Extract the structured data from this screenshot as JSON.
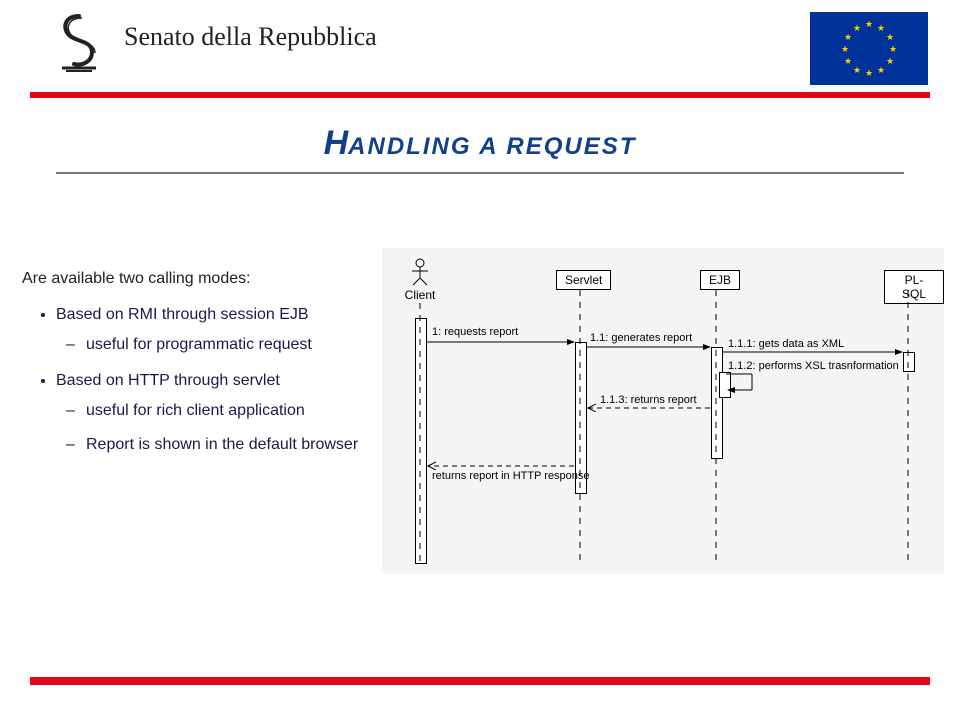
{
  "header": {
    "org_name": "Senato della Repubblica",
    "flag_name": "eu-flag"
  },
  "title": {
    "first_letter": "H",
    "rest": "ANDLING A REQUEST"
  },
  "body": {
    "intro": "Are available two calling modes:",
    "items": [
      {
        "label": "Based on RMI through session EJB",
        "sub": [
          "useful for programmatic request"
        ]
      },
      {
        "label": "Based on HTTP through servlet",
        "sub": [
          "useful for rich client application",
          "Report is shown in the default browser"
        ]
      }
    ]
  },
  "diagram": {
    "type": "uml-sequence",
    "actor": "Client",
    "lifelines": [
      "Servlet",
      "EJB",
      "PL-SQL"
    ],
    "messages": {
      "m1": "1: requests report",
      "m11": "1.1: generates report",
      "m111": "1.1.1: gets data as XML",
      "m112": "1.1.2: performs XSL trasnformation",
      "m113": "1.1.3: returns report",
      "ret": "returns report in HTTP response"
    }
  },
  "chart_data": {
    "type": "sequence-diagram",
    "participants": [
      {
        "name": "Client",
        "kind": "actor"
      },
      {
        "name": "Servlet",
        "kind": "object"
      },
      {
        "name": "EJB",
        "kind": "object"
      },
      {
        "name": "PL-SQL",
        "kind": "object"
      }
    ],
    "messages": [
      {
        "seq": "1",
        "from": "Client",
        "to": "Servlet",
        "label": "requests report",
        "style": "call"
      },
      {
        "seq": "1.1",
        "from": "Servlet",
        "to": "EJB",
        "label": "generates report",
        "style": "call"
      },
      {
        "seq": "1.1.1",
        "from": "EJB",
        "to": "PL-SQL",
        "label": "gets data as XML",
        "style": "call"
      },
      {
        "seq": "1.1.2",
        "from": "EJB",
        "to": "EJB",
        "label": "performs XSL trasnformation",
        "style": "self"
      },
      {
        "seq": "1.1.3",
        "from": "EJB",
        "to": "Servlet",
        "label": "returns report",
        "style": "return"
      },
      {
        "seq": "",
        "from": "Servlet",
        "to": "Client",
        "label": "returns report in HTTP response",
        "style": "return"
      }
    ]
  },
  "colors": {
    "brand_red": "#e30613",
    "title_blue": "#123f8c",
    "eu_blue": "#003399",
    "eu_gold": "#ffcc00"
  }
}
